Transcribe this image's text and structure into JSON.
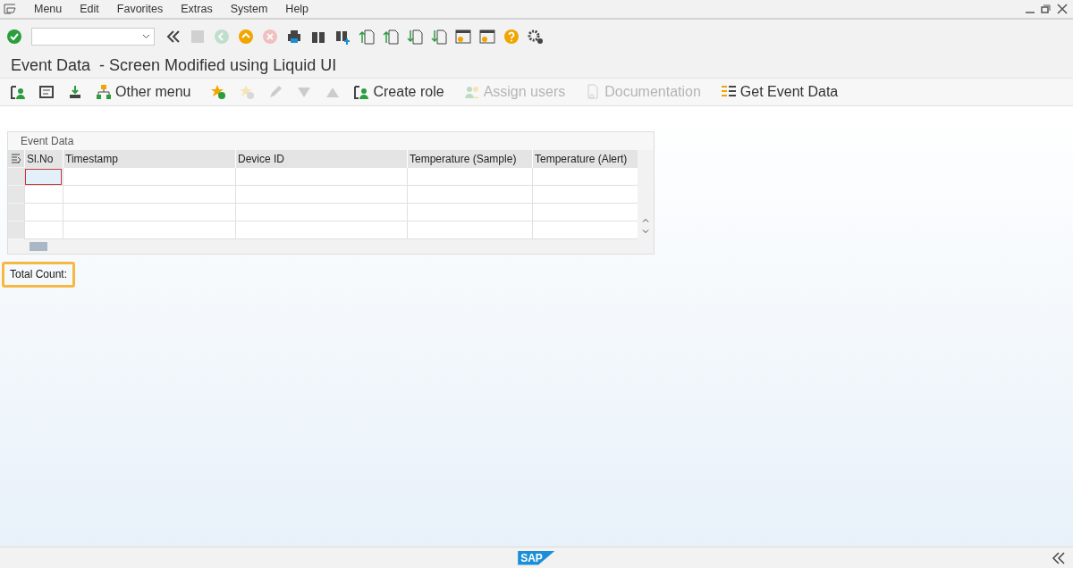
{
  "menu_bar": [
    "Menu",
    "Edit",
    "Favorites",
    "Extras",
    "System",
    "Help"
  ],
  "system_toolbar": [
    {
      "kind": "check",
      "disabled": false
    },
    {
      "kind": "command-field"
    },
    {
      "kind": "chevrons",
      "disabled": false
    },
    {
      "kind": "save",
      "disabled": true
    },
    {
      "kind": "back",
      "disabled": true
    },
    {
      "kind": "up",
      "disabled": false
    },
    {
      "kind": "cancel",
      "disabled": true
    },
    {
      "kind": "print",
      "disabled": false
    },
    {
      "kind": "find",
      "disabled": false
    },
    {
      "kind": "find-next",
      "disabled": false
    },
    {
      "kind": "page-first",
      "disabled": false
    },
    {
      "kind": "page-prev",
      "disabled": false
    },
    {
      "kind": "page-next",
      "disabled": false
    },
    {
      "kind": "page-last",
      "disabled": false
    },
    {
      "kind": "window-star",
      "disabled": false
    },
    {
      "kind": "window-arrow",
      "disabled": false
    },
    {
      "kind": "help",
      "disabled": false
    },
    {
      "kind": "gear",
      "disabled": false
    }
  ],
  "title": "Event Data  - Screen Modified using Liquid UI",
  "app_toolbar": [
    {
      "kind": "person",
      "disabled": false
    },
    {
      "kind": "form",
      "disabled": false
    },
    {
      "kind": "import",
      "disabled": false
    },
    {
      "kind": "hierarchy",
      "label": "Other menu",
      "disabled": false
    },
    {
      "kind": "star-add",
      "disabled": false
    },
    {
      "kind": "star-remove",
      "disabled": true
    },
    {
      "kind": "pencil",
      "disabled": true
    },
    {
      "kind": "down",
      "disabled": true
    },
    {
      "kind": "up",
      "disabled": true
    },
    {
      "kind": "person",
      "label": "Create role",
      "disabled": false
    },
    {
      "kind": "users",
      "label": "Assign users",
      "disabled": true
    },
    {
      "kind": "document",
      "label": "Documentation",
      "disabled": true
    },
    {
      "kind": "list",
      "label": "Get Event Data",
      "disabled": false
    }
  ],
  "table": {
    "title": "Event Data",
    "columns": [
      "Sl.No",
      "Timestamp",
      "Device ID",
      "Temperature (Sample)",
      "Temperature (Alert)"
    ],
    "rows": [
      {
        "focused": true
      },
      {
        "focused": false
      },
      {
        "focused": false
      },
      {
        "focused": false
      }
    ]
  },
  "total_count": {
    "label": "Total Count:",
    "highlighted": true
  },
  "footer": {
    "logo": "SAP"
  }
}
